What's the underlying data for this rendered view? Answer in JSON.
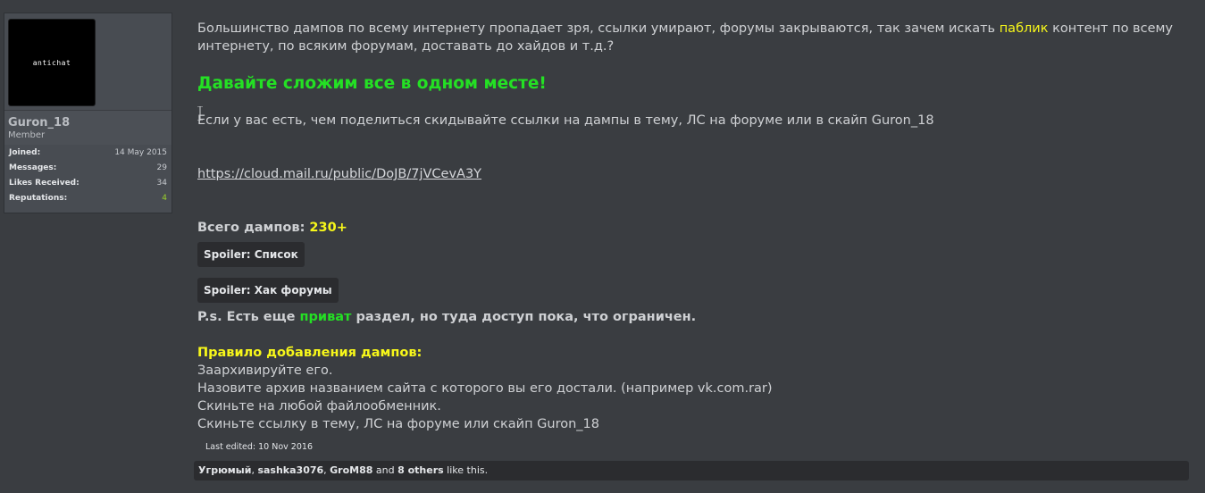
{
  "sidebar": {
    "avatar_text": "antichat",
    "username": "Guron_18",
    "usertitle": "Member",
    "stats": [
      {
        "label": "Joined:",
        "value": "14 May 2015"
      },
      {
        "label": "Messages:",
        "value": "29"
      },
      {
        "label": "Likes Received:",
        "value": "34"
      },
      {
        "label": "Reputations:",
        "value": "4"
      }
    ]
  },
  "post": {
    "p1_a": "Большинство дампов по всему интернету пропадает зря, ссылки умирают, форумы закрываются, так зачем искать ",
    "p1_hl": "паблик",
    "p1_b": " контент по всему интернету, по всяким форумам, доставать до хайдов и т.д.?",
    "headline": "Давайте сложим все в одном месте!",
    "p2": "Если у вас есть, чем поделиться скидывайте ссылки на дампы в тему, ЛС на форуме или в скайп Guron_18",
    "link": "https://cloud.mail.ru/public/DoJB/7jVCevA3Y",
    "total_label": "Всего дампов: ",
    "total_value": "230+",
    "spoiler1": "Spoiler: Список",
    "spoiler2": "Spoiler: Хак форумы",
    "ps_a": "P.s. Есть еще ",
    "ps_hl": "приват",
    "ps_b": " раздел, но туда доступ пока, что ограничен.",
    "rules_title": "Правило добавления дампов:",
    "rules": [
      "Заархивируйте его.",
      "Назовите архив названием сайта с которого вы его достали. (например vk.com.rar)",
      "Скиньте на любой файлообменник.",
      "Скиньте ссылку в тему, ЛС на форуме или скайп Guron_18"
    ],
    "last_edited": "Last edited: 10 Nov 2016"
  },
  "likes": {
    "user1": "Угрюмый",
    "sep1": ", ",
    "user2": "sashka3076",
    "sep2": ", ",
    "user3": "GroM88",
    "and": " and ",
    "others": "8 others",
    "suffix": " like this."
  },
  "colors": {
    "highlight_yellow": "#f7f71a",
    "highlight_green": "#24e024",
    "reputation_green": "#9ad02b"
  }
}
